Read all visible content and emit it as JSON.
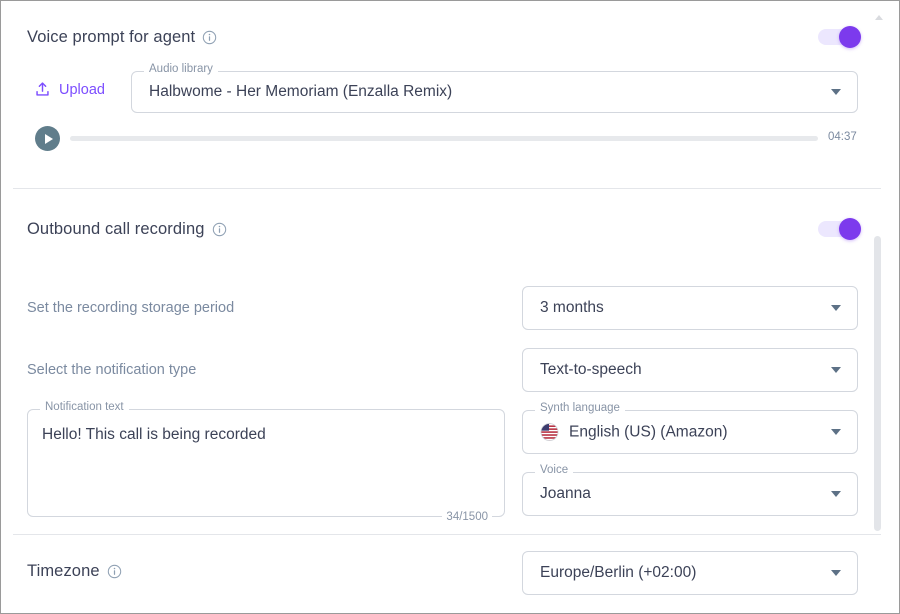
{
  "sections": {
    "voice_prompt": {
      "title": "Voice prompt for agent",
      "info_icon": "info-circle-icon",
      "toggle_state": "on",
      "upload_label": "Upload",
      "upload_icon": "upload-icon",
      "audio_library": {
        "legend": "Audio library",
        "value": "Halbwome - Her Memoriam (Enzalla Remix)",
        "caret_icon": "chevron-down-icon"
      },
      "player": {
        "play_icon": "play-icon",
        "duration": "04:37",
        "progress_percent": 0
      }
    },
    "outbound_recording": {
      "title": "Outbound call recording",
      "info_icon": "info-circle-icon",
      "toggle_state": "on",
      "storage_period": {
        "label": "Set the recording storage period",
        "value": "3 months",
        "caret_icon": "chevron-down-icon"
      },
      "notification_type": {
        "label": "Select the notification type",
        "value": "Text-to-speech",
        "caret_icon": "chevron-down-icon"
      },
      "notification_text": {
        "legend": "Notification text",
        "value": "Hello! This call is being recorded",
        "counter": "34/1500"
      },
      "synth_language": {
        "legend": "Synth language",
        "value": "English (US) (Amazon)",
        "flag_icon": "us-flag-icon",
        "caret_icon": "chevron-down-icon"
      },
      "voice": {
        "legend": "Voice",
        "value": "Joanna",
        "caret_icon": "chevron-down-icon"
      }
    },
    "timezone": {
      "title": "Timezone",
      "info_icon": "info-circle-icon",
      "value": "Europe/Berlin (+02:00)",
      "caret_icon": "chevron-down-icon"
    }
  },
  "colors": {
    "accent_purple": "#7c3aed",
    "upload_purple": "#7c4dff",
    "text_primary": "#3c4257",
    "text_muted": "#7b8aa0",
    "border": "#d3d7de",
    "divider": "#e4e6ea"
  }
}
